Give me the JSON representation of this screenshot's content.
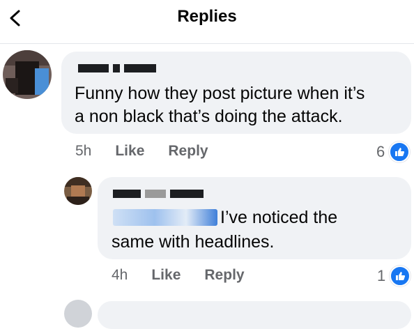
{
  "header": {
    "title": "Replies"
  },
  "comments": [
    {
      "text_line1": "Funny how they post picture when it’s",
      "text_line2": "a non black that’s doing the attack.",
      "time": "5h",
      "like_label": "Like",
      "reply_label": "Reply",
      "reaction_count": "6"
    },
    {
      "text_line1": "I’ve noticed the",
      "text_line2": "same with headlines.",
      "time": "4h",
      "like_label": "Like",
      "reply_label": "Reply",
      "reaction_count": "1"
    }
  ],
  "colors": {
    "accent": "#1877f2",
    "bubble": "#f0f2f5",
    "meta": "#65676b"
  }
}
